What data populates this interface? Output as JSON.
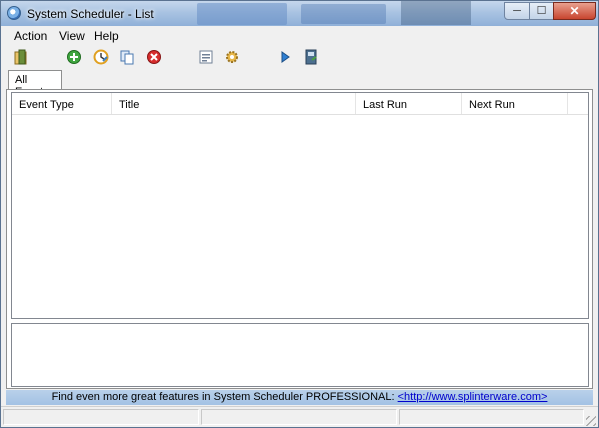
{
  "window": {
    "title": "System Scheduler - List"
  },
  "window_controls": {
    "minimize": "─",
    "maximize": "☐",
    "close": "✕"
  },
  "menu": [
    "Action",
    "View",
    "Help"
  ],
  "toolbar": [
    {
      "icon": "exit-icon"
    },
    {
      "icon": "new-event-icon"
    },
    {
      "icon": "edit-event-icon"
    },
    {
      "icon": "copy-event-icon"
    },
    {
      "icon": "delete-event-icon"
    },
    {
      "icon": "properties-icon"
    },
    {
      "icon": "settings-gear-icon"
    },
    {
      "icon": "run-icon"
    },
    {
      "icon": "log-icon"
    }
  ],
  "tabs": [
    {
      "label": "All Events",
      "active": true
    }
  ],
  "list": {
    "columns": [
      "Event Type",
      "Title",
      "Last Run",
      "Next Run"
    ],
    "rows": []
  },
  "promo": {
    "text": "Find even more great features in System Scheduler PROFESSIONAL:",
    "link": "<http://www.splinterware.com>"
  },
  "colors": {
    "titlebar": "#a9c3e2",
    "promo_bar": "#b9d1ea",
    "close_button": "#c8452f"
  }
}
